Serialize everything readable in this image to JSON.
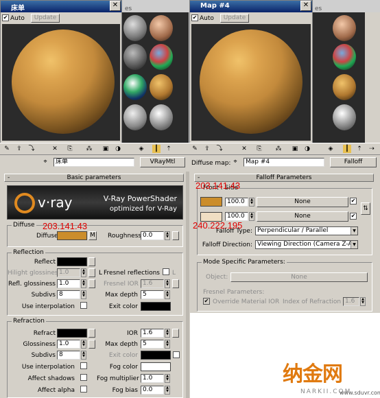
{
  "left_window": {
    "title": "床单",
    "auto_label": "Auto",
    "update_label": "Update"
  },
  "right_window": {
    "title": "Map #4",
    "auto_label": "Auto",
    "update_label": "Update"
  },
  "bg_tab_text": "es",
  "left_panel": {
    "material_name": "床单",
    "material_type": "VRayMtl",
    "rollout_title": "Basic parameters",
    "logo": {
      "brand": "v·ray",
      "product": "V-Ray PowerShader",
      "tagline": "optimized for V-Ray"
    },
    "diffuse": {
      "group": "Diffuse",
      "label": "Diffuse",
      "m_label": "M",
      "roughness_label": "Roughness",
      "roughness_value": "0.0",
      "annotation": "203.141.43",
      "color": "#cb8d2b"
    },
    "reflection": {
      "group": "Reflection",
      "reflect_label": "Reflect",
      "hilight_label": "Hilight glossiness",
      "hilight_value": "1.0",
      "l_label": "L",
      "fresnel_label": "Fresnel reflections",
      "refl_gloss_label": "Refl. glossiness",
      "refl_gloss_value": "1.0",
      "fresnel_ior_label": "Fresnel IOR",
      "fresnel_ior_value": "1.6",
      "subdivs_label": "Subdivs",
      "subdivs_value": "8",
      "max_depth_label": "Max depth",
      "max_depth_value": "5",
      "interp_label": "Use interpolation",
      "exit_label": "Exit color"
    },
    "refraction": {
      "group": "Refraction",
      "refract_label": "Refract",
      "ior_label": "IOR",
      "ior_value": "1.6",
      "gloss_label": "Glossiness",
      "gloss_value": "1.0",
      "max_depth_label": "Max depth",
      "max_depth_value": "5",
      "subdivs_label": "Subdivs",
      "subdivs_value": "8",
      "exit_label": "Exit color",
      "interp_label": "Use interpolation",
      "fog_color_label": "Fog color",
      "shadows_label": "Affect shadows",
      "fog_mult_label": "Fog multiplier",
      "fog_mult_value": "1.0",
      "alpha_label": "Affect alpha",
      "fog_bias_label": "Fog bias",
      "fog_bias_value": "0.0"
    }
  },
  "right_panel": {
    "map_label": "Diffuse map:",
    "map_name": "Map #4",
    "map_type": "Falloff",
    "rollout_title": "Falloff Parameters",
    "front_side_label": "Front : Side",
    "annotation_top": "203.141.43",
    "annotation_bottom": "240.222.195",
    "color1": "#cb8d2b",
    "color2": "#f0dec3",
    "row1_value": "100.0",
    "row1_map": "None",
    "row2_value": "100.0",
    "row2_map": "None",
    "falloff_type_label": "Falloff Type:",
    "falloff_type_value": "Perpendicular / Parallel",
    "falloff_dir_label": "Falloff Direction:",
    "falloff_dir_value": "Viewing Direction (Camera Z-Axis)",
    "mode_group": "Mode Specific Parameters:",
    "object_label": "Object:",
    "object_value": "None",
    "fresnel_params_label": "Fresnel Parameters:",
    "override_label": "Override Material IOR",
    "ior_label": "Index of Refraction",
    "ior_value": "1.6"
  },
  "watermark": {
    "logo": "纳金网",
    "sub": "NARKII.COM",
    "url": "www.sduvr.com"
  }
}
